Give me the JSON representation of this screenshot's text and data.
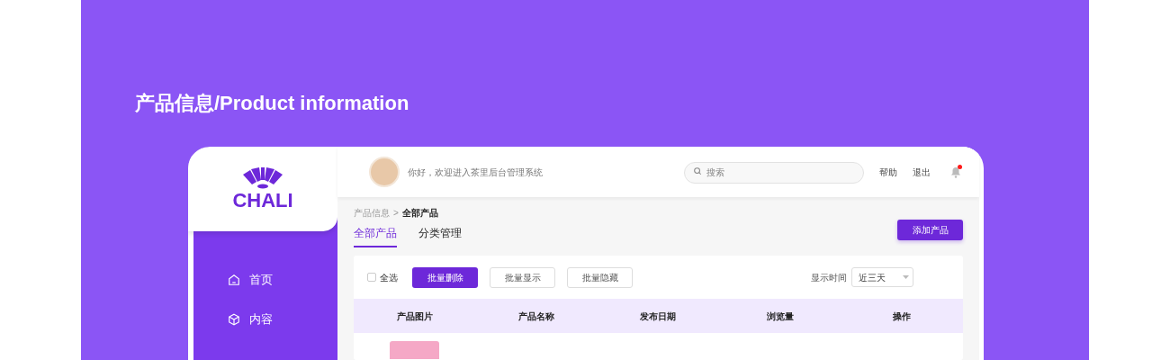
{
  "page_title": "产品信息/Product information",
  "sidebar": {
    "logo_text": "CHALI",
    "items": [
      {
        "label": "首页",
        "kind": "home",
        "selected": false
      },
      {
        "label": "内容",
        "kind": "box",
        "selected": false
      }
    ]
  },
  "header": {
    "greeting": "你好，欢迎进入茶里后台管理系统",
    "search": {
      "placeholder": "搜索"
    },
    "links": [
      "帮助",
      "退出"
    ],
    "notification_dot": true
  },
  "breadcrumb": {
    "items": [
      "产品信息",
      "全部产品"
    ],
    "separator": ">"
  },
  "tabs": [
    {
      "label": "全部产品",
      "selected": true
    },
    {
      "label": "分类管理",
      "selected": false
    }
  ],
  "add_button": "添加产品",
  "toolbar": {
    "select_all": {
      "label": "全选",
      "checked": false
    },
    "buttons": [
      {
        "label": "批量删除",
        "kind": "primary"
      },
      {
        "label": "批量显示",
        "kind": "default"
      },
      {
        "label": "批量隐藏",
        "kind": "default"
      }
    ],
    "time_filter": {
      "label": "显示时间",
      "value": "近三天"
    }
  },
  "table": {
    "columns": [
      "产品图片",
      "产品名称",
      "发布日期",
      "浏览量",
      "操作"
    ]
  }
}
